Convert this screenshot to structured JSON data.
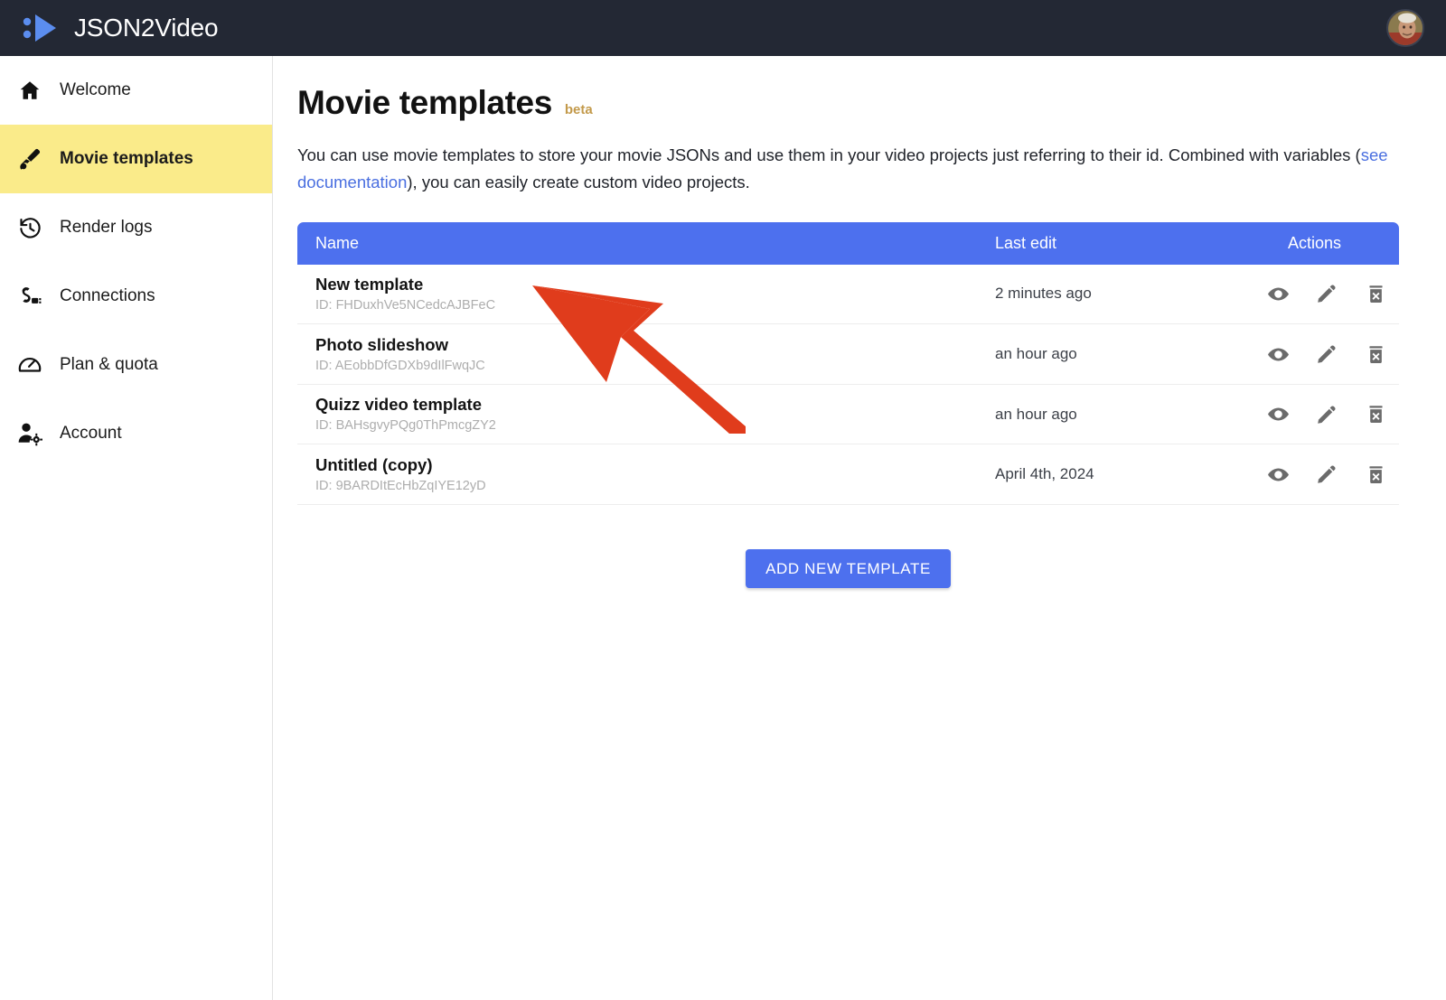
{
  "brand": {
    "title": "JSON2Video",
    "logo_icon": "play-triangle-logo-icon",
    "avatar_icon": "user-avatar"
  },
  "colors": {
    "topbar_bg": "#232834",
    "accent_blue": "#4d70ee",
    "active_nav_bg": "#faeb8a",
    "link_blue": "#4a6fe0",
    "beta_badge": "#c39a4b",
    "annotation_red": "#e03c1c",
    "muted_text": "#adadad"
  },
  "sidebar": {
    "items": [
      {
        "label": "Welcome",
        "icon": "home-icon",
        "active": false
      },
      {
        "label": "Movie templates",
        "icon": "brush-icon",
        "active": true
      },
      {
        "label": "Render logs",
        "icon": "history-icon",
        "active": false
      },
      {
        "label": "Connections",
        "icon": "plug-icon",
        "active": false
      },
      {
        "label": "Plan & quota",
        "icon": "gauge-icon",
        "active": false
      },
      {
        "label": "Account",
        "icon": "user-gear-icon",
        "active": false
      }
    ]
  },
  "page": {
    "title": "Movie templates",
    "badge": "beta",
    "description_part1": "You can use movie templates to store your movie JSONs and use them in your video projects just referring to their id. Combined with variables (",
    "description_link": "see documentation",
    "description_part2": "), you can easily create custom video projects."
  },
  "table": {
    "headers": {
      "name": "Name",
      "last_edit": "Last edit",
      "actions": "Actions"
    },
    "id_prefix": "ID: ",
    "action_icons": [
      {
        "name": "eye-icon",
        "title": "View"
      },
      {
        "name": "pencil-icon",
        "title": "Edit"
      },
      {
        "name": "trash-x-icon",
        "title": "Delete"
      }
    ],
    "rows": [
      {
        "name": "New template",
        "id": "FHDuxhVe5NCedcAJBFeC",
        "last_edit": "2 minutes ago"
      },
      {
        "name": "Photo slideshow",
        "id": "AEobbDfGDXb9dIlFwqJC",
        "last_edit": "an hour ago"
      },
      {
        "name": "Quizz video template",
        "id": "BAHsgvyPQg0ThPmcgZY2",
        "last_edit": "an hour ago"
      },
      {
        "name": "Untitled (copy)",
        "id": "9BARDItEcHbZqIYE12yD",
        "last_edit": "April 4th, 2024"
      }
    ]
  },
  "actions": {
    "add_new_template": "ADD NEW TEMPLATE"
  },
  "annotation": {
    "type": "arrow",
    "points_to": "new-template-row",
    "color": "#e03c1c"
  }
}
